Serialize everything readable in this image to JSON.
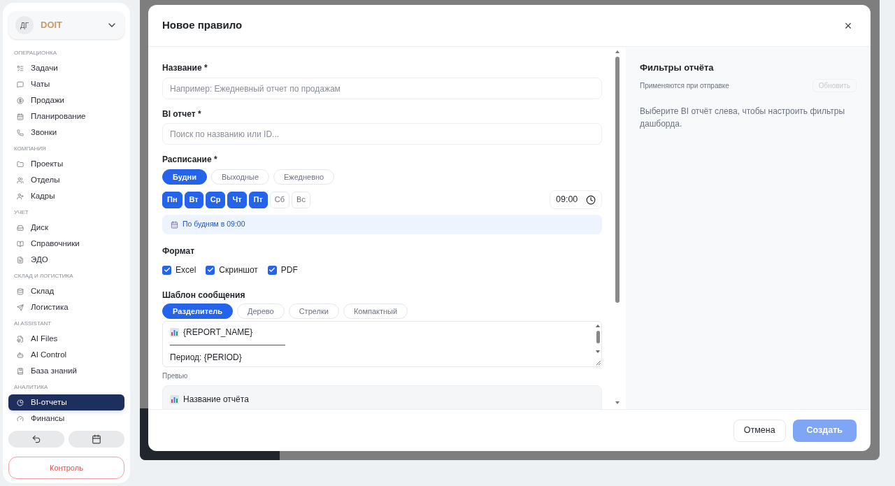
{
  "sidebar": {
    "avatar": "ДГ",
    "org": "DOIT",
    "sections": [
      {
        "title": "ОПЕРАЦИОНКА",
        "items": [
          {
            "label": "Задачи",
            "selected": false
          },
          {
            "label": "Чаты",
            "selected": false
          },
          {
            "label": "Продажи",
            "selected": false
          },
          {
            "label": "Планирование",
            "selected": false
          },
          {
            "label": "Звонки",
            "selected": false
          }
        ]
      },
      {
        "title": "КОМПАНИЯ",
        "items": [
          {
            "label": "Проекты",
            "selected": false
          },
          {
            "label": "Отделы",
            "selected": false
          },
          {
            "label": "Кадры",
            "selected": false
          }
        ]
      },
      {
        "title": "УЧЕТ",
        "items": [
          {
            "label": "Диск",
            "selected": false
          },
          {
            "label": "Справочники",
            "selected": false
          },
          {
            "label": "ЭДО",
            "selected": false
          }
        ]
      },
      {
        "title": "СКЛАД И ЛОГИСТИКА",
        "items": [
          {
            "label": "Склад",
            "selected": false
          },
          {
            "label": "Логистика",
            "selected": false
          }
        ]
      },
      {
        "title": "AI ASSISTANT",
        "items": [
          {
            "label": "AI Files",
            "selected": false
          },
          {
            "label": "AI Control",
            "selected": false
          },
          {
            "label": "База знаний",
            "selected": false
          }
        ]
      },
      {
        "title": "АНАЛИТИКА",
        "items": [
          {
            "label": "BI-отчеты",
            "selected": true
          },
          {
            "label": "Финансы",
            "selected": false
          }
        ]
      }
    ],
    "control_button": "Контроль"
  },
  "modal": {
    "title": "Новое правило",
    "close": "×",
    "name_field": {
      "label": "Название *",
      "placeholder": "Например: Ежедневный отчет по продажам"
    },
    "report_field": {
      "label": "BI отчет *",
      "placeholder": "Поиск по названию или ID..."
    },
    "schedule": {
      "label": "Расписание *",
      "presets": [
        {
          "label": "Будни",
          "selected": true
        },
        {
          "label": "Выходные",
          "selected": false
        },
        {
          "label": "Ежедневно",
          "selected": false
        }
      ],
      "days": [
        {
          "label": "Пн",
          "selected": true
        },
        {
          "label": "Вт",
          "selected": true
        },
        {
          "label": "Ср",
          "selected": true
        },
        {
          "label": "Чт",
          "selected": true
        },
        {
          "label": "Пт",
          "selected": true
        },
        {
          "label": "Сб",
          "selected": false
        },
        {
          "label": "Вс",
          "selected": false
        }
      ],
      "time": "09:00",
      "summary": "По будням в 09:00"
    },
    "format": {
      "label": "Формат",
      "options": [
        {
          "label": "Excel",
          "checked": true
        },
        {
          "label": "Скриншот",
          "checked": true
        },
        {
          "label": "PDF",
          "checked": true
        }
      ]
    },
    "template": {
      "label": "Шаблон сообщения",
      "styles": [
        {
          "label": "Разделитель",
          "selected": true
        },
        {
          "label": "Дерево",
          "selected": false
        },
        {
          "label": "Стрелки",
          "selected": false
        },
        {
          "label": "Компактный",
          "selected": false
        }
      ],
      "lines": [
        {
          "kind": "title",
          "text": "{REPORT_NAME}"
        },
        {
          "kind": "rule"
        },
        {
          "kind": "text",
          "text": "Период: {PERIOD}"
        }
      ]
    },
    "preview": {
      "label": "Превью",
      "title": "Название отчёта"
    },
    "filters": {
      "title": "Фильтры отчёта",
      "subtitle": "Применяются при отправке",
      "refresh": {
        "label": "Обновить",
        "disabled": true
      },
      "hint": "Выберите BI отчёт слева, чтобы настроить фильтры дашборда."
    },
    "cancel": "Отмена",
    "submit": {
      "label": "Создать",
      "disabled": true
    }
  }
}
